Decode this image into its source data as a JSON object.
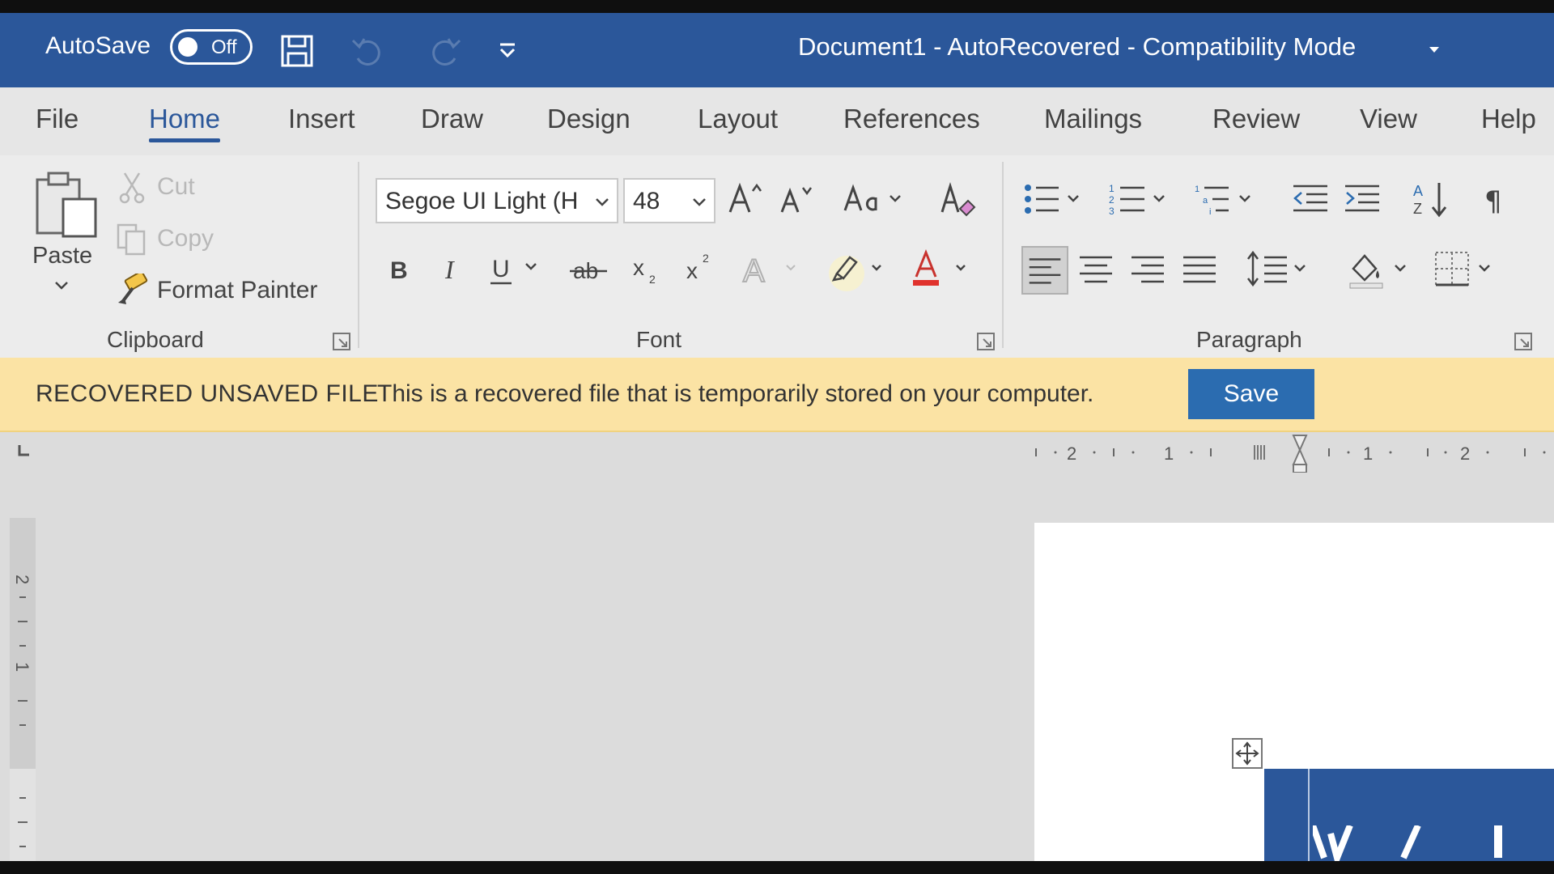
{
  "titlebar": {
    "autosave_label": "AutoSave",
    "autosave_state": "Off",
    "document_title": "Document1  -  AutoRecovered  -  Compatibility Mode",
    "accent_color": "#2b579a"
  },
  "tabs": [
    {
      "label": "File"
    },
    {
      "label": "Home"
    },
    {
      "label": "Insert"
    },
    {
      "label": "Draw"
    },
    {
      "label": "Design"
    },
    {
      "label": "Layout"
    },
    {
      "label": "References"
    },
    {
      "label": "Mailings"
    },
    {
      "label": "Review"
    },
    {
      "label": "View"
    },
    {
      "label": "Help"
    }
  ],
  "active_tab": "Home",
  "clipboard": {
    "group_label": "Clipboard",
    "paste_label": "Paste",
    "cut_label": "Cut",
    "copy_label": "Copy",
    "format_painter_label": "Format Painter"
  },
  "font": {
    "group_label": "Font",
    "font_name": "Segoe UI Light (H",
    "font_size": "48"
  },
  "paragraph": {
    "group_label": "Paragraph"
  },
  "message_bar": {
    "title": "RECOVERED UNSAVED FILE",
    "text": "This is a recovered file that is temporarily stored on your computer.",
    "button_label": "Save",
    "background_color": "#fbe3a4",
    "button_color": "#2b6cb0"
  },
  "ruler": {
    "horizontal_labels": [
      "2",
      "1",
      "1",
      "2"
    ],
    "vertical_labels": [
      "2",
      "1"
    ]
  }
}
